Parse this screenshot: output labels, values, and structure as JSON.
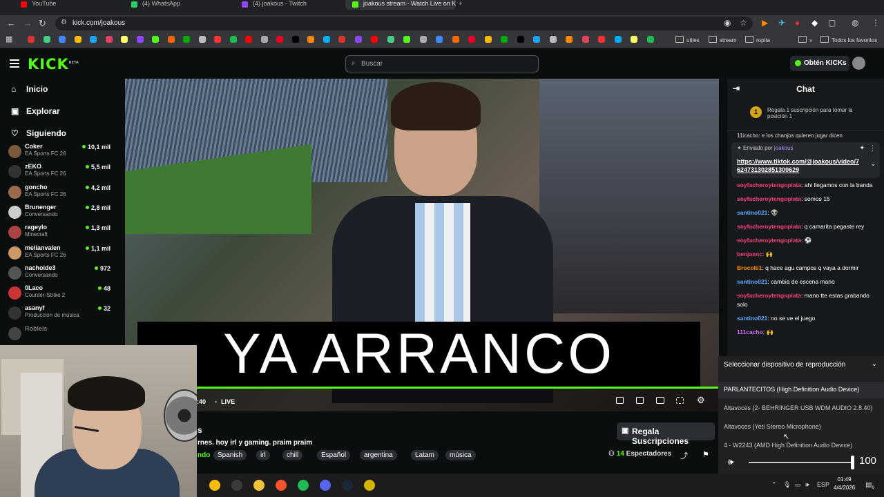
{
  "browser": {
    "tabs": [
      {
        "label": "YouTube",
        "color": "#ff0000"
      },
      {
        "label": "(4) WhatsApp",
        "color": "#25d366"
      },
      {
        "label": "(4) joakous - Twitch",
        "color": "#9146ff"
      },
      {
        "label": "joakous stream - Watch Live on Kick",
        "color": "#53fc18"
      }
    ],
    "new_tab": "+",
    "url": "kick.com/joakous",
    "bookmark_folders": [
      "utiles",
      "stream",
      "ropita"
    ],
    "all_bookmarks": "Todos los favoritos",
    "bookmark_colors": [
      "#d33",
      "#4c8",
      "#48f",
      "#fb0",
      "#1da1f2",
      "#e4405f",
      "#ff6",
      "#9146ff",
      "#53fc18",
      "#f60",
      "#0a0",
      "#bbb",
      "#f33",
      "#1db954",
      "#ff0000",
      "#aaa",
      "#e60023",
      "#000",
      "#f80",
      "#0af"
    ]
  },
  "kick": {
    "logo": "KICK",
    "logo_badge": "BETA",
    "search_placeholder": "Buscar",
    "get_kicks": "Obtén KICKs",
    "nav": [
      {
        "icon": "home-icon",
        "glyph": "⌂",
        "label": "Inicio"
      },
      {
        "icon": "browse-icon",
        "glyph": "▣",
        "label": "Explorar"
      },
      {
        "icon": "heart-icon",
        "glyph": "♡",
        "label": "Siguiendo"
      }
    ],
    "following": [
      {
        "name": "Coker",
        "game": "EA Sports FC 26",
        "viewers": "10,1 mil",
        "color": "#7a5a3a"
      },
      {
        "name": "zEKO",
        "game": "EA Sports FC 26",
        "viewers": "5,5 mil",
        "color": "#333"
      },
      {
        "name": "goncho",
        "game": "EA Sports FC 26",
        "viewers": "4,2 mil",
        "color": "#9a6a4a"
      },
      {
        "name": "Brunenger",
        "game": "Conversando",
        "viewers": "2,8 mil",
        "color": "#ccc"
      },
      {
        "name": "rageylo",
        "game": "Minecraft",
        "viewers": "1,3 mil",
        "color": "#a44"
      },
      {
        "name": "melianvalen",
        "game": "EA Sports FC 26",
        "viewers": "1,1 mil",
        "color": "#c96"
      },
      {
        "name": "nachoide3",
        "game": "Conversando",
        "viewers": "972",
        "color": "#555"
      },
      {
        "name": "0Laco",
        "game": "Counter-Strike 2",
        "viewers": "48",
        "color": "#c33"
      },
      {
        "name": "asanyf",
        "game": "Producción de música",
        "viewers": "32",
        "color": "#333"
      },
      {
        "name": "Robleis",
        "game": "",
        "viewers": "",
        "color": "#888"
      }
    ],
    "player": {
      "overlay_text": "YA ARRANCO",
      "time": ":40",
      "live": "LIVE",
      "progress_fraction": 1.0
    },
    "stream": {
      "title": "s",
      "description": "rnes. hoy irl y gaming. praim praim",
      "category": "ndo",
      "tags": [
        "Spanish",
        "irl",
        "chill",
        "Español",
        "argentina",
        "Latam",
        "música"
      ],
      "gift_button": "Regala Suscripciones",
      "viewers_count": "14",
      "viewers_label": "Espectadores"
    },
    "chat": {
      "title": "Chat",
      "gift_rank": "1",
      "gift_text": "Regala 1 suscripción para tomar la posición 1",
      "cut_line": "11icacho: e los chanjos quieren jugar dicen",
      "pinned_by_label": "Enviado por",
      "pinned_by_user": "joakous",
      "pinned_link": "https://www.tiktok.com/@joakous/video/7624731302851300629",
      "messages": [
        {
          "user": "soyfacheroytengoplata",
          "color": "pink",
          "text": "ahi llegamos con la banda"
        },
        {
          "user": "soyfacheroytengoplata",
          "color": "pink",
          "text": "somos 15"
        },
        {
          "user": "santino021",
          "color": "blue",
          "text": "👽"
        },
        {
          "user": "soyfacheroytengoplata",
          "color": "pink",
          "text": "q camarita pegaste rey"
        },
        {
          "user": "soyfacheroytengoplata",
          "color": "pink",
          "text": "⚽"
        },
        {
          "user": "benjasnc",
          "color": "pink",
          "text": "🙌"
        },
        {
          "user": "Brocolii1",
          "color": "orange",
          "text": "q hace agu campos q vaya a dormir"
        },
        {
          "user": "santino021",
          "color": "blue",
          "text": "cambia de escena mano"
        },
        {
          "user": "soyfacheroytengoplata",
          "color": "pink",
          "text": "mano tte estas grabando solo"
        },
        {
          "user": "santino021",
          "color": "blue",
          "text": "no se ve el juego"
        },
        {
          "user": "111cacho",
          "color": "purple",
          "text": "🙌"
        }
      ]
    }
  },
  "audio_menu": {
    "header": "Seleccionar dispositivo de reproducción",
    "options": [
      "PARLANTECITOS (High Definition Audio Device)",
      "Altavoces (2- BEHRINGER USB WDM AUDIO 2.8.40)",
      "Altavoces (Yeti Stereo Microphone)",
      "4 - W2243 (AMD High Definition Audio Device)"
    ],
    "volume": "100",
    "volume_fraction": 1.0
  },
  "taskbar": {
    "apps": [
      {
        "name": "chrome-icon",
        "color": "#fbbc05"
      },
      {
        "name": "obs-icon",
        "color": "#3a3a3a"
      },
      {
        "name": "folder-icon",
        "color": "#f3c13a"
      },
      {
        "name": "brave-icon",
        "color": "#fb542b"
      },
      {
        "name": "spotify-icon",
        "color": "#1db954"
      },
      {
        "name": "discord-icon",
        "color": "#5865f2"
      },
      {
        "name": "steam-icon",
        "color": "#1b2838"
      },
      {
        "name": "app-icon",
        "color": "#d4b400"
      }
    ],
    "lang": "ESP",
    "time": "01:49",
    "date": "4/4/2026",
    "notification_count": "6"
  }
}
